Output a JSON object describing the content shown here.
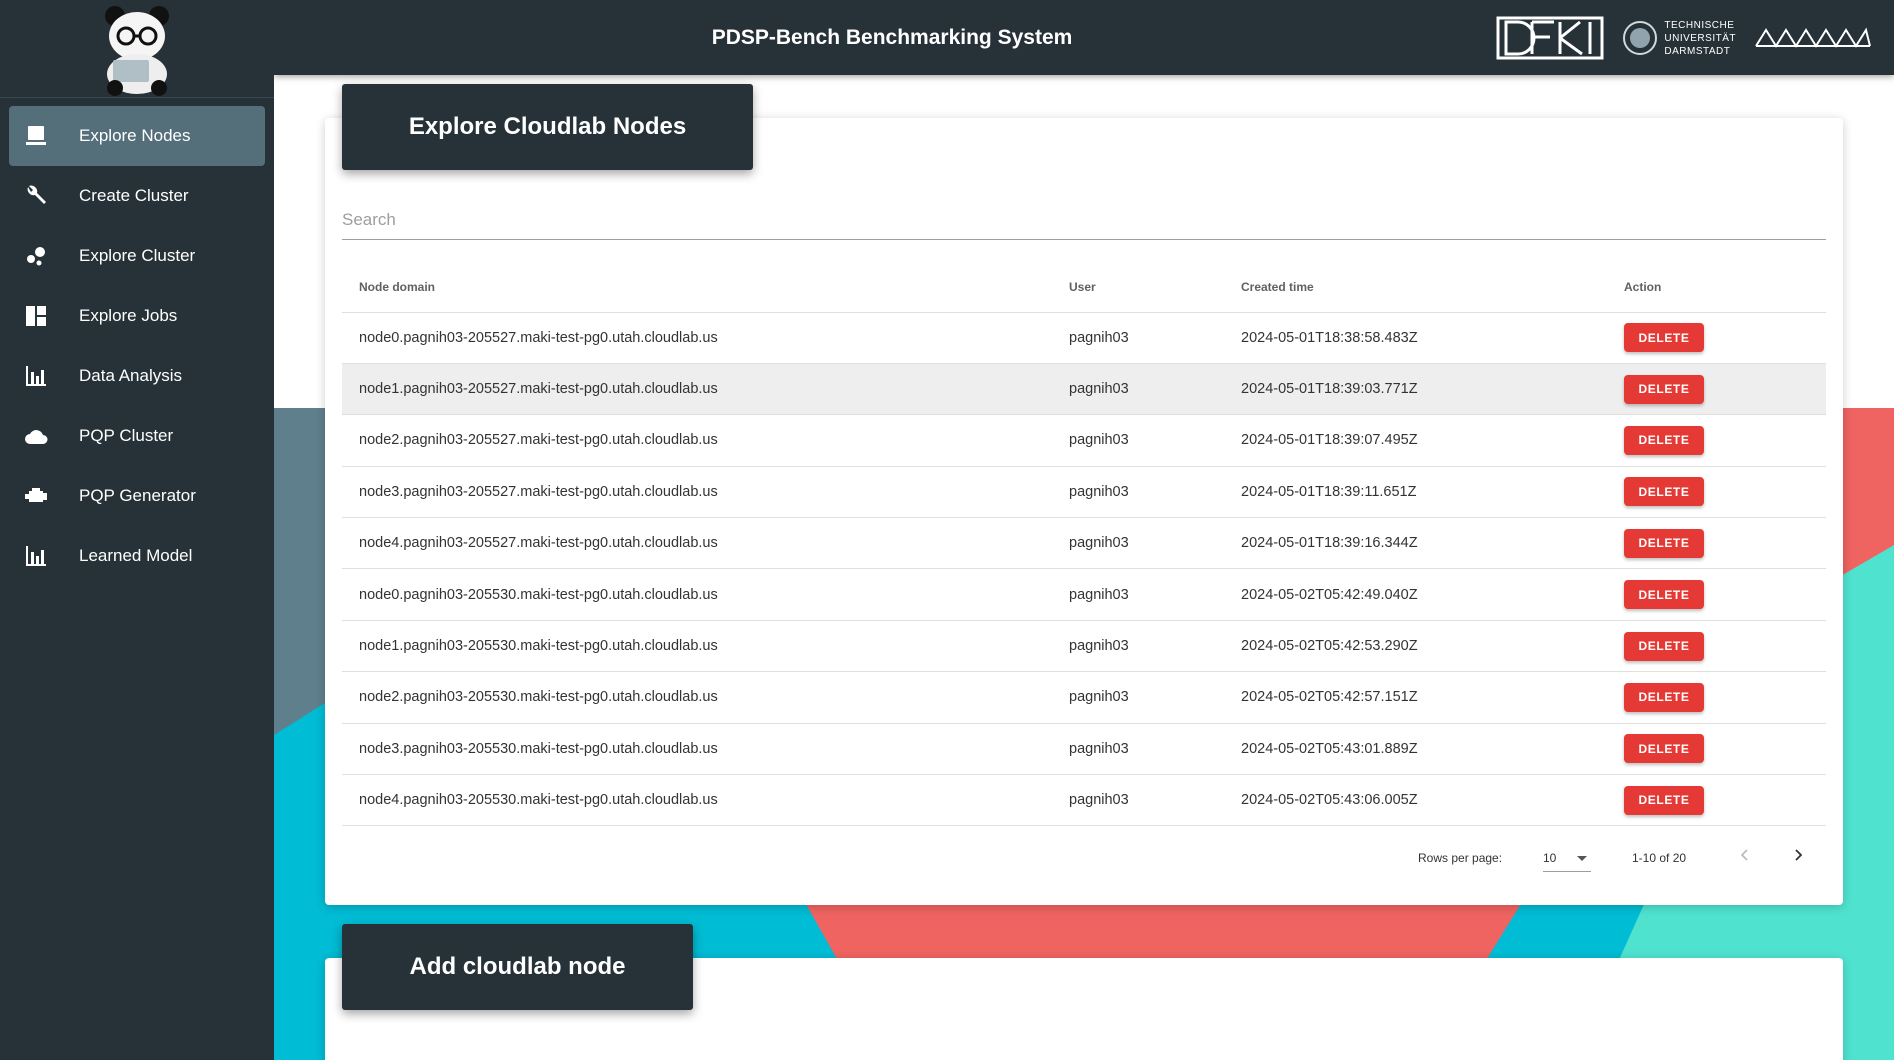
{
  "header": {
    "title": "PDSP-Bench Benchmarking System"
  },
  "sidebar": {
    "items": [
      {
        "label": "Explore Nodes",
        "icon": "computer-icon",
        "active": true
      },
      {
        "label": "Create Cluster",
        "icon": "wrench-icon"
      },
      {
        "label": "Explore Cluster",
        "icon": "bubbles-icon"
      },
      {
        "label": "Explore Jobs",
        "icon": "dashboard-icon"
      },
      {
        "label": "Data Analysis",
        "icon": "bar-chart-icon"
      },
      {
        "label": "PQP Cluster",
        "icon": "cloud-icon"
      },
      {
        "label": "PQP Generator",
        "icon": "engine-icon"
      },
      {
        "label": "Learned Model",
        "icon": "bar-chart-icon"
      }
    ]
  },
  "explore_card": {
    "title": "Explore Cloudlab Nodes",
    "search_placeholder": "Search",
    "columns": [
      "Node domain",
      "User",
      "Created time",
      "Action"
    ],
    "rows": [
      {
        "domain": "node0.pagnih03-205527.maki-test-pg0.utah.cloudlab.us",
        "user": "pagnih03",
        "created": "2024-05-01T18:38:58.483Z"
      },
      {
        "domain": "node1.pagnih03-205527.maki-test-pg0.utah.cloudlab.us",
        "user": "pagnih03",
        "created": "2024-05-01T18:39:03.771Z"
      },
      {
        "domain": "node2.pagnih03-205527.maki-test-pg0.utah.cloudlab.us",
        "user": "pagnih03",
        "created": "2024-05-01T18:39:07.495Z"
      },
      {
        "domain": "node3.pagnih03-205527.maki-test-pg0.utah.cloudlab.us",
        "user": "pagnih03",
        "created": "2024-05-01T18:39:11.651Z"
      },
      {
        "domain": "node4.pagnih03-205527.maki-test-pg0.utah.cloudlab.us",
        "user": "pagnih03",
        "created": "2024-05-01T18:39:16.344Z"
      },
      {
        "domain": "node0.pagnih03-205530.maki-test-pg0.utah.cloudlab.us",
        "user": "pagnih03",
        "created": "2024-05-02T05:42:49.040Z"
      },
      {
        "domain": "node1.pagnih03-205530.maki-test-pg0.utah.cloudlab.us",
        "user": "pagnih03",
        "created": "2024-05-02T05:42:53.290Z"
      },
      {
        "domain": "node2.pagnih03-205530.maki-test-pg0.utah.cloudlab.us",
        "user": "pagnih03",
        "created": "2024-05-02T05:42:57.151Z"
      },
      {
        "domain": "node3.pagnih03-205530.maki-test-pg0.utah.cloudlab.us",
        "user": "pagnih03",
        "created": "2024-05-02T05:43:01.889Z"
      },
      {
        "domain": "node4.pagnih03-205530.maki-test-pg0.utah.cloudlab.us",
        "user": "pagnih03",
        "created": "2024-05-02T05:43:06.005Z"
      }
    ],
    "delete_label": "DELETE",
    "rows_per_page_label": "Rows per page:",
    "rows_per_page_value": "10",
    "page_range": "1-10 of 20"
  },
  "add_card": {
    "title": "Add cloudlab node"
  },
  "logos": {
    "tu": [
      "TECHNISCHE",
      "UNIVERSITÄT",
      "DARMSTADT"
    ]
  },
  "colors": {
    "dark": "#263238",
    "accent_active": "#546e7a",
    "delete": "#e53935",
    "teal": "#00bcd4",
    "coral": "#ef6461",
    "mint": "#4fe3cf"
  }
}
